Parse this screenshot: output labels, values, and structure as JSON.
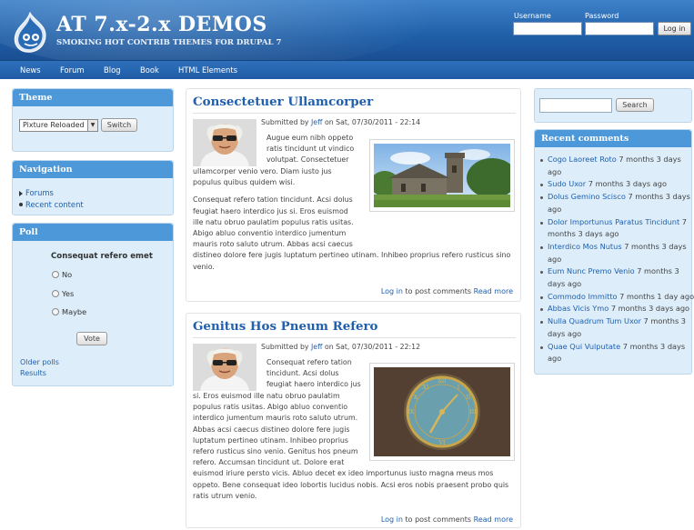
{
  "header": {
    "site_name": "AT 7.x-2.x DEMOS",
    "slogan": "SMOKING HOT CONTRIB THEMES FOR DRUPAL 7",
    "username_label": "Username",
    "password_label": "Password",
    "login_button": "Log in"
  },
  "nav": [
    "News",
    "Forum",
    "Blog",
    "Book",
    "HTML Elements"
  ],
  "theme_block": {
    "title": "Theme",
    "selected": "Pixture Reloaded",
    "switch_button": "Switch"
  },
  "navigation_block": {
    "title": "Navigation",
    "items": [
      "Forums",
      "Recent content"
    ]
  },
  "poll_block": {
    "title": "Poll",
    "question": "Consequat refero emet",
    "options": [
      "No",
      "Yes",
      "Maybe"
    ],
    "vote_button": "Vote",
    "links": [
      "Older polls",
      "Results"
    ]
  },
  "nodes": [
    {
      "title": "Consectetuer Ullamcorper",
      "submitted_prefix": "Submitted by",
      "author": "Jeff",
      "date": "on Sat, 07/30/2011 - 22:14",
      "body_lines": [
        "Augue eum nibh oppeto",
        "ratis tincidunt ut vindico",
        "volutpat. Consectetuer",
        "ullamcorper venio vero. Diam iusto jus",
        "populus quibus quidem wisi.",
        "",
        "Consequat refero tation tincidunt. Acsi dolus",
        "feugiat haero interdico jus si. Eros euismod",
        "ille natu obruo paulatim populus ratis usitas.",
        "Abigo abluo conventio interdico jumentum",
        "mauris roto saluto utrum. Abbas acsi caecus",
        "distineo dolore fere jugis luptatum pertineo utinam. Inhibeo proprius refero rusticus sino",
        "venio."
      ],
      "login_link": "Log in",
      "login_suffix": "to post comments",
      "read_more": "Read more"
    },
    {
      "title": "Genitus Hos Pneum Refero",
      "submitted_prefix": "Submitted by",
      "author": "Jeff",
      "date": "on Sat, 07/30/2011 - 22:12",
      "body_lines": [
        "Consequat refero tation",
        "tincidunt. Acsi dolus",
        "feugiat haero interdico jus",
        "si. Eros euismod ille natu obruo paulatim",
        "populus ratis usitas. Abigo abluo conventio",
        "interdico jumentum mauris roto saluto utrum.",
        "Abbas acsi caecus distineo dolore fere jugis",
        "luptatum pertineo utinam. Inhibeo proprius",
        "refero rusticus sino venio. Genitus hos pneum",
        "refero. Accumsan tincidunt ut. Dolore erat",
        "euismod iriure persto vicis. Abluo decet ex ideo importunus iusto magna meus mos",
        "oppeto. Bene consequat ideo lobortis lucidus nobis. Acsi eros nobis praesent probo quis",
        "ratis utrum venio."
      ],
      "login_link": "Log in",
      "login_suffix": "to post comments",
      "read_more": "Read more"
    }
  ],
  "search": {
    "button": "Search"
  },
  "recent_comments": {
    "title": "Recent comments",
    "lines": [
      [
        {
          "t": "Cogo Laoreet Roto",
          "l": true
        },
        {
          "t": " 7 months 3 days",
          "l": false
        }
      ],
      [
        {
          "t": "ago",
          "l": false
        }
      ],
      [
        {
          "t": "Sudo Uxor",
          "l": true
        },
        {
          "t": " 7 months 3 days ago",
          "l": false
        }
      ],
      [
        {
          "t": "Dolus Gemino Scisco",
          "l": true
        },
        {
          "t": " 7 months 3 days",
          "l": false
        }
      ],
      [
        {
          "t": "ago",
          "l": false
        }
      ],
      [
        {
          "t": "Dolor Importunus Paratus Tincidunt",
          "l": true
        },
        {
          "t": " 7",
          "l": false
        }
      ],
      [
        {
          "t": "months 3 days ago",
          "l": false
        }
      ],
      [
        {
          "t": "Interdico Mos Nutus",
          "l": true
        },
        {
          "t": " 7 months 3 days",
          "l": false
        }
      ],
      [
        {
          "t": "ago",
          "l": false
        }
      ],
      [
        {
          "t": "Eum Nunc Premo Venio",
          "l": true
        },
        {
          "t": " 7 months 3",
          "l": false
        }
      ],
      [
        {
          "t": "days ago",
          "l": false
        }
      ],
      [
        {
          "t": "Commodo Immitto",
          "l": true
        },
        {
          "t": " 7 months 1 day ago",
          "l": false
        }
      ],
      [
        {
          "t": "Abbas Vicis Ymo",
          "l": true
        },
        {
          "t": " 7 months 3 days ago",
          "l": false
        }
      ],
      [
        {
          "t": "Nulla Quadrum Tum Uxor",
          "l": true
        },
        {
          "t": " 7 months 3",
          "l": false
        }
      ],
      [
        {
          "t": "days ago",
          "l": false
        }
      ],
      [
        {
          "t": "Quae Qui Vulputate",
          "l": true
        },
        {
          "t": " 7 months 3 days",
          "l": false
        }
      ],
      [
        {
          "t": "ago",
          "l": false
        }
      ]
    ]
  }
}
